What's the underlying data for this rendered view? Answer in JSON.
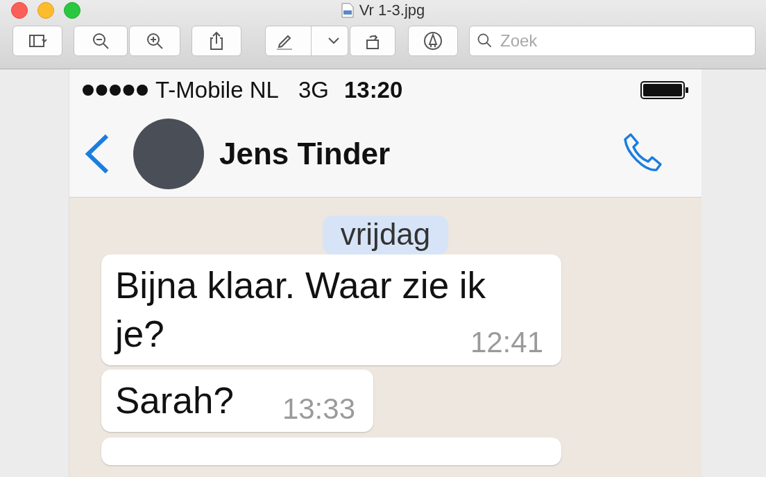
{
  "window": {
    "title": "Vr 1-3.jpg"
  },
  "toolbar": {
    "search": {
      "placeholder": "Zoek"
    }
  },
  "phone": {
    "status_bar": {
      "carrier": "T-Mobile NL",
      "network": "3G",
      "time": "13:20"
    },
    "chat_header": {
      "name": "Jens Tinder"
    },
    "date_label": "vrijdag",
    "messages": [
      {
        "text": "Bijna klaar. Waar zie ik je?",
        "time": "12:41"
      },
      {
        "text": "Sarah?",
        "time": "13:33"
      }
    ]
  }
}
